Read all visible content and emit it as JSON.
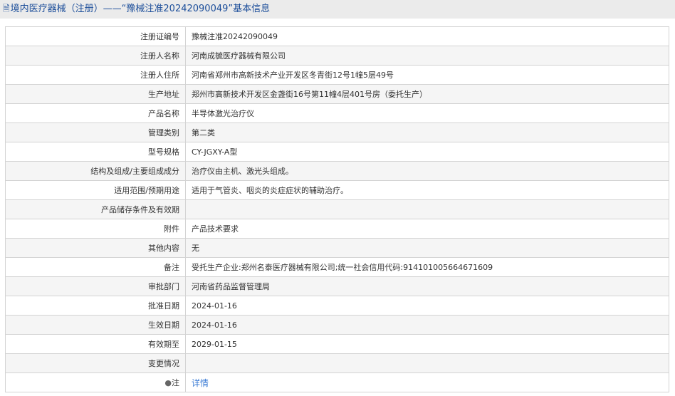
{
  "header": {
    "prefix": "境内医疗器械（注册）——",
    "title": "“豫械注准20242090049”基本信息"
  },
  "rows": [
    {
      "label": "注册证编号",
      "value": "豫械注准20242090049"
    },
    {
      "label": "注册人名称",
      "value": "河南成毓医疗器械有限公司"
    },
    {
      "label": "注册人住所",
      "value": "河南省郑州市高新技术产业开发区冬青街12号1幢5层49号"
    },
    {
      "label": "生产地址",
      "value": "郑州市高新技术开发区金盏街16号第11幢4层401号房（委托生产）"
    },
    {
      "label": "产品名称",
      "value": "半导体激光治疗仪"
    },
    {
      "label": "管理类别",
      "value": "第二类"
    },
    {
      "label": "型号规格",
      "value": "CY-JGXY-A型"
    },
    {
      "label": "结构及组成/主要组成成分",
      "value": "治疗仪由主机、激光头组成。"
    },
    {
      "label": "适用范围/预期用途",
      "value": "适用于气管炎、咽炎的炎症症状的辅助治疗。"
    },
    {
      "label": "产品储存条件及有效期",
      "value": ""
    },
    {
      "label": "附件",
      "value": "产品技术要求"
    },
    {
      "label": "其他内容",
      "value": "无"
    },
    {
      "label": "备注",
      "value": "受托生产企业:郑州名泰医疗器械有限公司;统一社会信用代码:91410100566467160​9"
    },
    {
      "label": "审批部门",
      "value": "河南省药品监督管理局"
    },
    {
      "label": "批准日期",
      "value": "2024-01-16"
    },
    {
      "label": "生效日期",
      "value": "2024-01-16"
    },
    {
      "label": "有效期至",
      "value": "2029-01-15"
    },
    {
      "label": "变更情况",
      "value": ""
    }
  ],
  "note": {
    "label": "注",
    "link": "详情"
  }
}
